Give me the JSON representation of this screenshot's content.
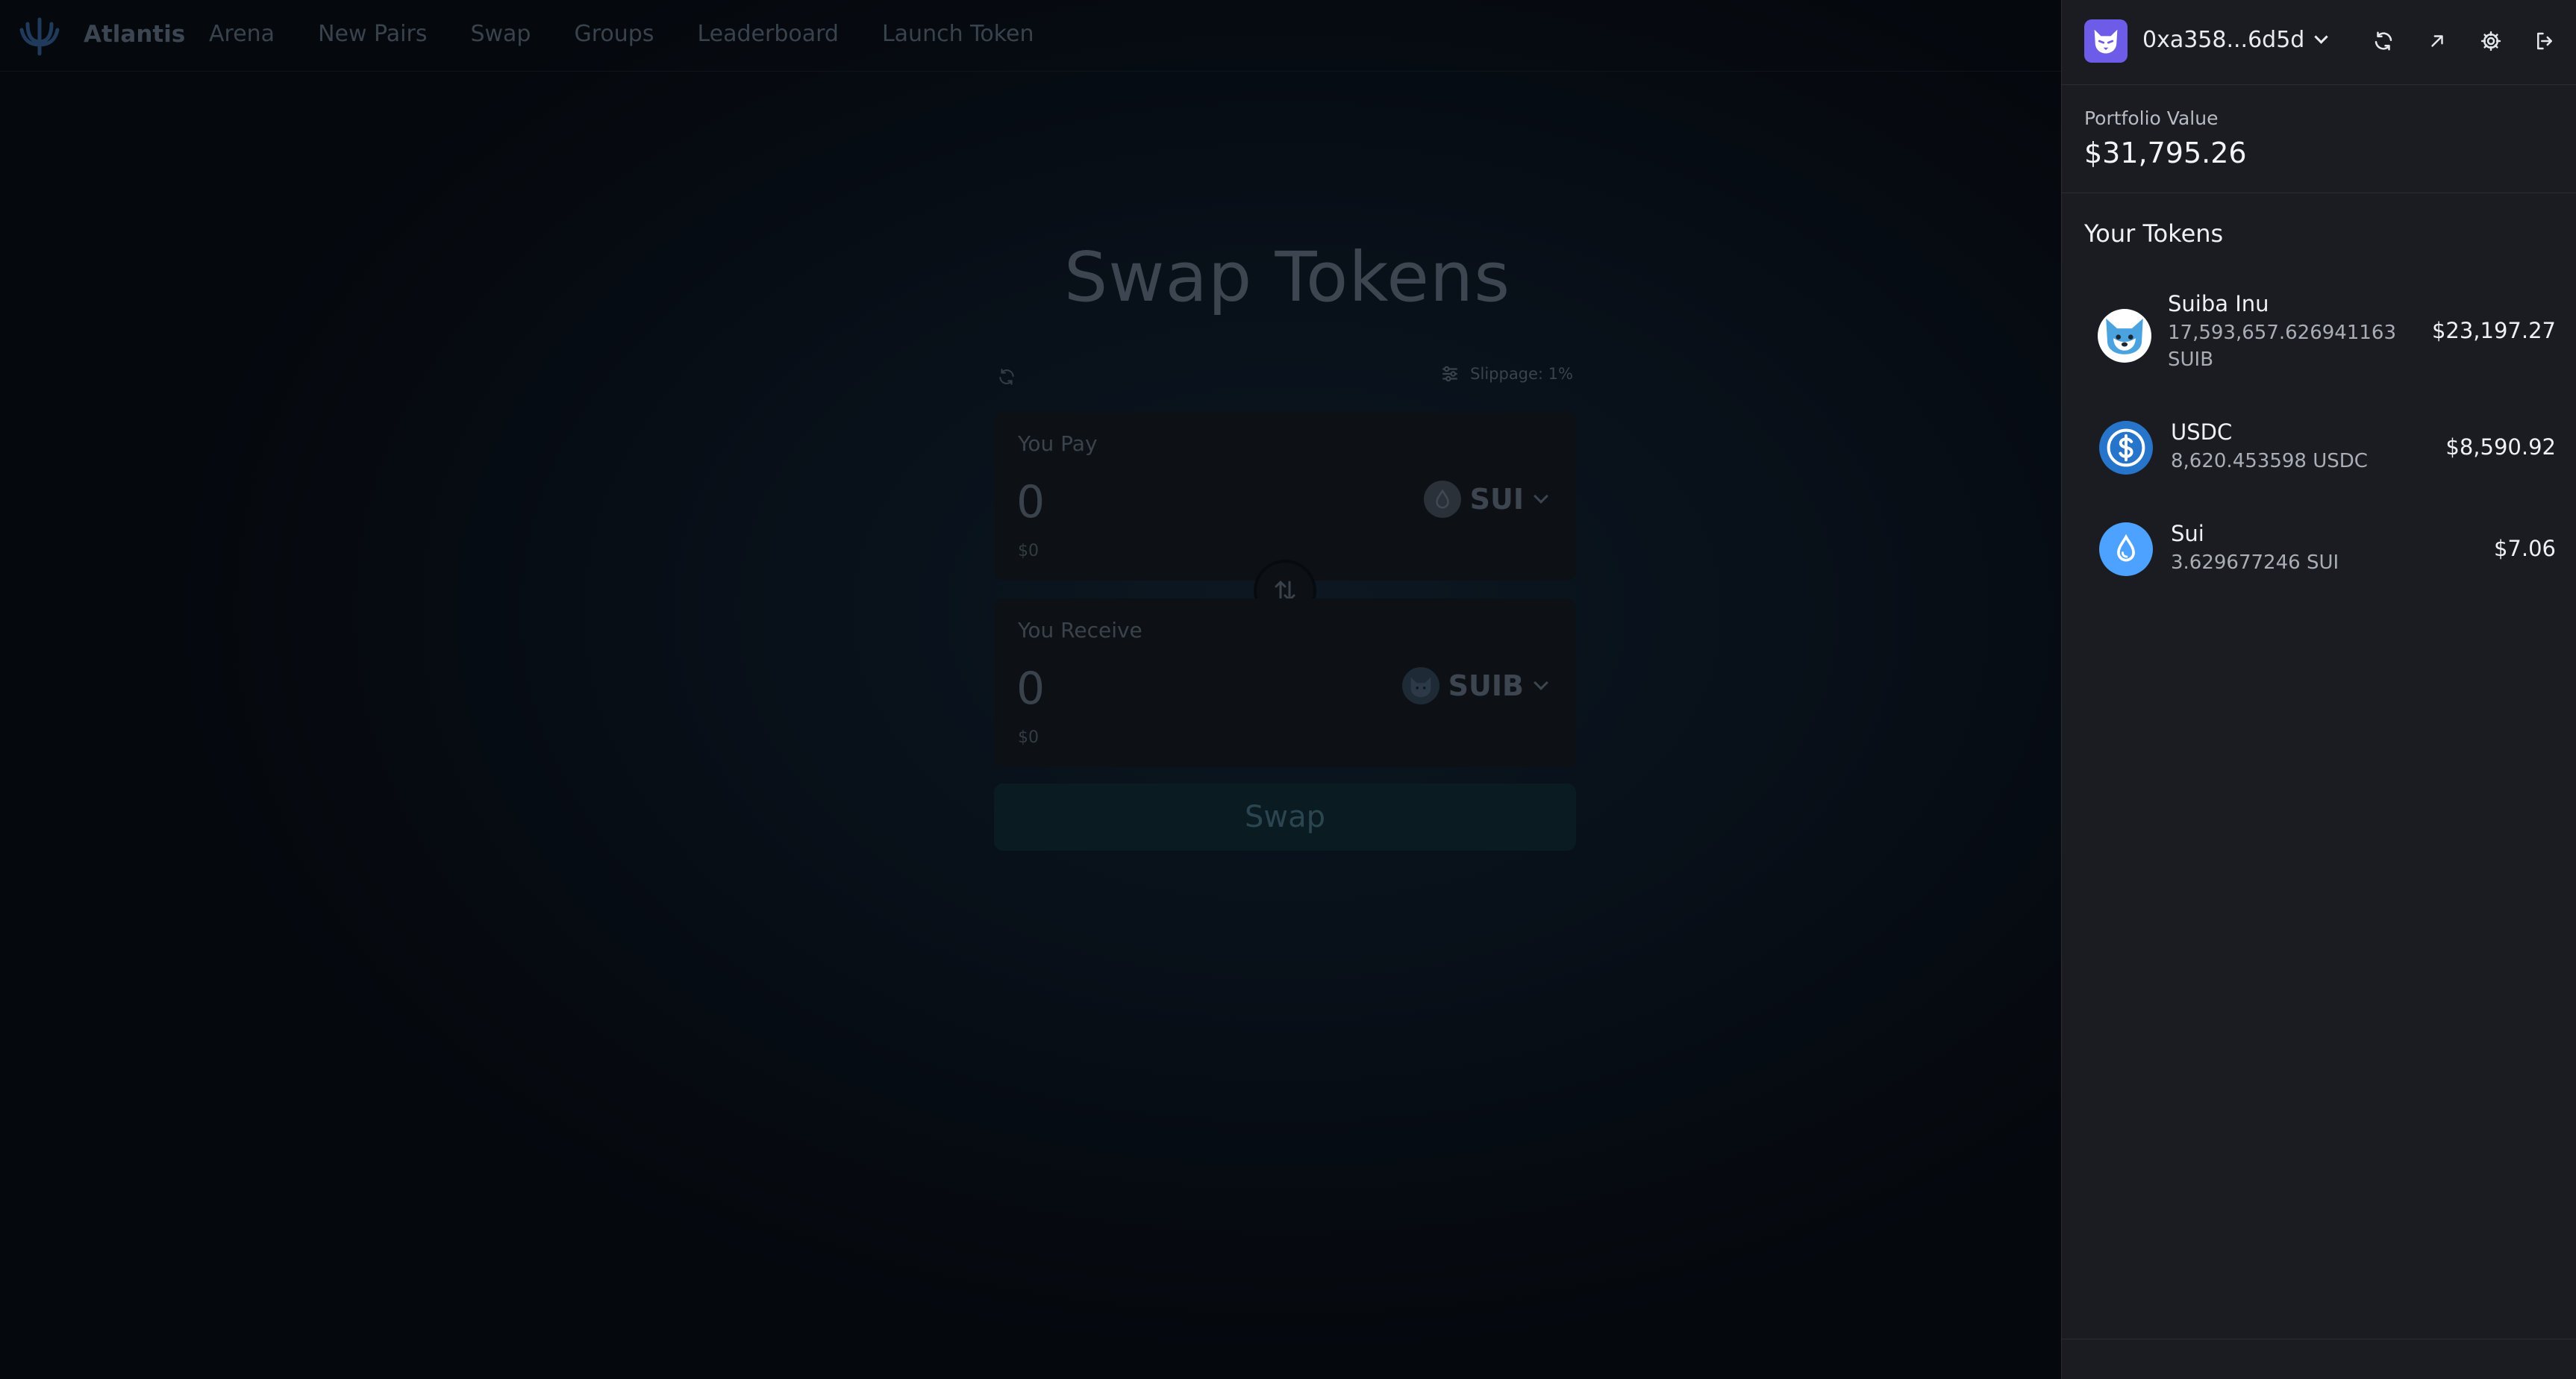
{
  "nav": {
    "brand": "Atlantis",
    "links": [
      "Arena",
      "New Pairs",
      "Swap",
      "Groups",
      "Leaderboard",
      "Launch Token"
    ]
  },
  "swap": {
    "title": "Swap Tokens",
    "slippage": "Slippage: 1%",
    "pay": {
      "label": "You Pay",
      "amount": "0",
      "usd": "$0",
      "token": "SUI"
    },
    "receive": {
      "label": "You Receive",
      "amount": "0",
      "usd": "$0",
      "token": "SUIB"
    },
    "button": "Swap"
  },
  "wallet": {
    "address": "0xa358...6d5d",
    "portfolio_label": "Portfolio Value",
    "portfolio_value": "$31,795.26",
    "tokens_heading": "Your Tokens",
    "tokens": [
      {
        "name": "Suiba Inu",
        "balance": "17,593,657.626941163 SUIB",
        "value": "$23,197.27",
        "icon": "shiba-icon"
      },
      {
        "name": "USDC",
        "balance": "8,620.453598 USDC",
        "value": "$8,590.92",
        "icon": "usdc-icon"
      },
      {
        "name": "Sui",
        "balance": "3.629677246 SUI",
        "value": "$7.06",
        "icon": "sui-drop-icon"
      }
    ]
  },
  "colors": {
    "accent": "#6c5ce7",
    "usdc_blue": "#2775ca",
    "sui_blue": "#4da2ff",
    "panel_bg": "#1a1c21"
  }
}
